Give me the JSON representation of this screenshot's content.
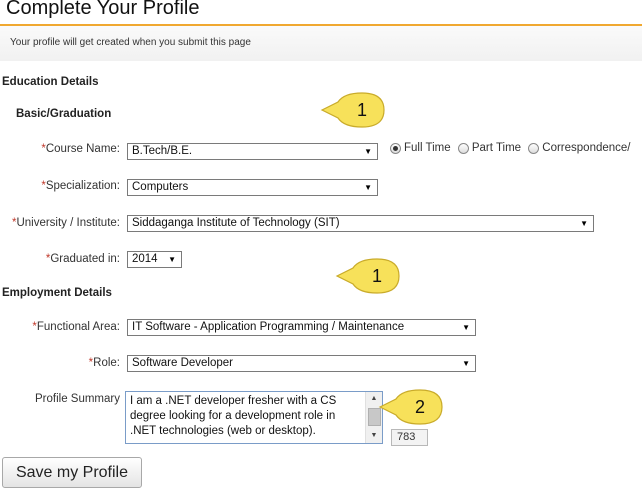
{
  "page": {
    "title": "Complete Your Profile",
    "subtitle": "Your profile will get created when you submit this page"
  },
  "education": {
    "section_title": "Education Details",
    "sub_title": "Basic/Graduation",
    "course": {
      "required_mark": "*",
      "label": "Course Name:",
      "value": "B.Tech/B.E."
    },
    "study_mode": {
      "options": [
        "Full Time",
        "Part Time",
        "Correspondence/"
      ],
      "selected": "Full Time"
    },
    "specialization": {
      "required_mark": "*",
      "label": "Specialization:",
      "value": "Computers"
    },
    "university": {
      "required_mark": "*",
      "label": "University / Institute:",
      "value": "Siddaganga Institute of Technology (SIT)"
    },
    "graduated": {
      "required_mark": "*",
      "label": "Graduated in:",
      "value": "2014"
    }
  },
  "employment": {
    "section_title": "Employment Details",
    "functional_area": {
      "required_mark": "*",
      "label": "Functional Area:",
      "value": "IT Software - Application Programming / Maintenance"
    },
    "role": {
      "required_mark": "*",
      "label": "Role:",
      "value": "Software Developer"
    },
    "profile_summary": {
      "label": "Profile Summary",
      "value": "I am a .NET developer fresher with a CS degree looking for a development role in .NET technologies (web or desktop).",
      "char_count": "783"
    }
  },
  "save_button_label": "Save my Profile",
  "callouts": [
    {
      "label": "1"
    },
    {
      "label": "1"
    },
    {
      "label": "2"
    }
  ],
  "colors": {
    "title_rule": "#f0a830",
    "required_star": "#c0392b",
    "callout_fill": "#f7e15a"
  }
}
